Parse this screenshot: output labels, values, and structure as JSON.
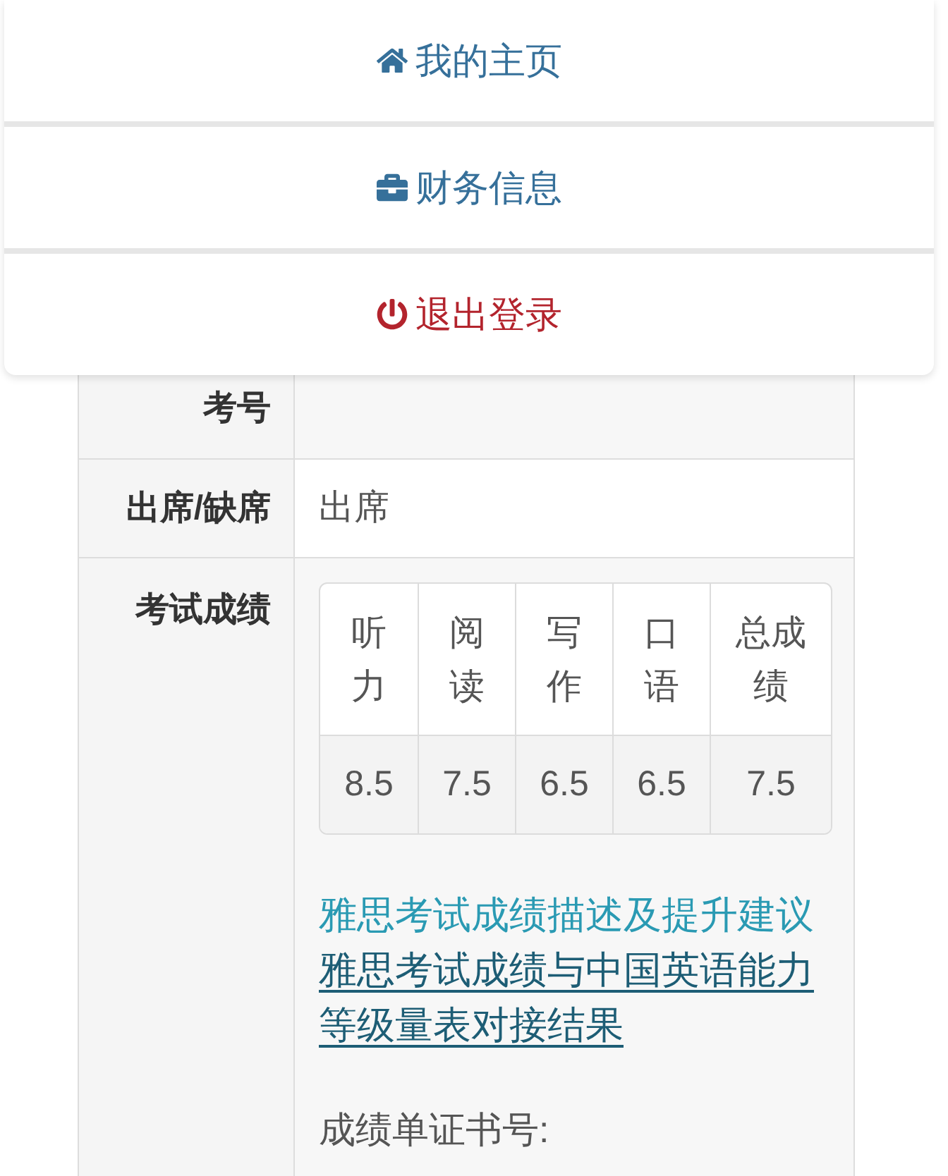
{
  "menu": {
    "items": [
      {
        "kind": "home",
        "label": "我的主页"
      },
      {
        "kind": "finance",
        "label": "财务信息"
      },
      {
        "kind": "logout",
        "label": "退出登录"
      }
    ]
  },
  "info_table": {
    "rows": [
      {
        "kind": "text",
        "label": "考号"
      },
      {
        "kind": "text",
        "label": "出席/缺席",
        "value": "出席"
      },
      {
        "kind": "scores",
        "label": "考试成绩",
        "scores": {
          "columns": [
            "听力",
            "阅读",
            "写作",
            "口语",
            "总成绩"
          ],
          "values": [
            "8.5",
            "7.5",
            "6.5",
            "6.5",
            "7.5"
          ]
        },
        "links": [
          {
            "text": "雅思考试成绩描述及提升建议",
            "underlined": false
          },
          {
            "text": "雅思考试成绩与中国英语能力等级量表对接结果",
            "underlined": true
          }
        ],
        "certificate_label": "成绩单证书号:"
      }
    ]
  }
}
